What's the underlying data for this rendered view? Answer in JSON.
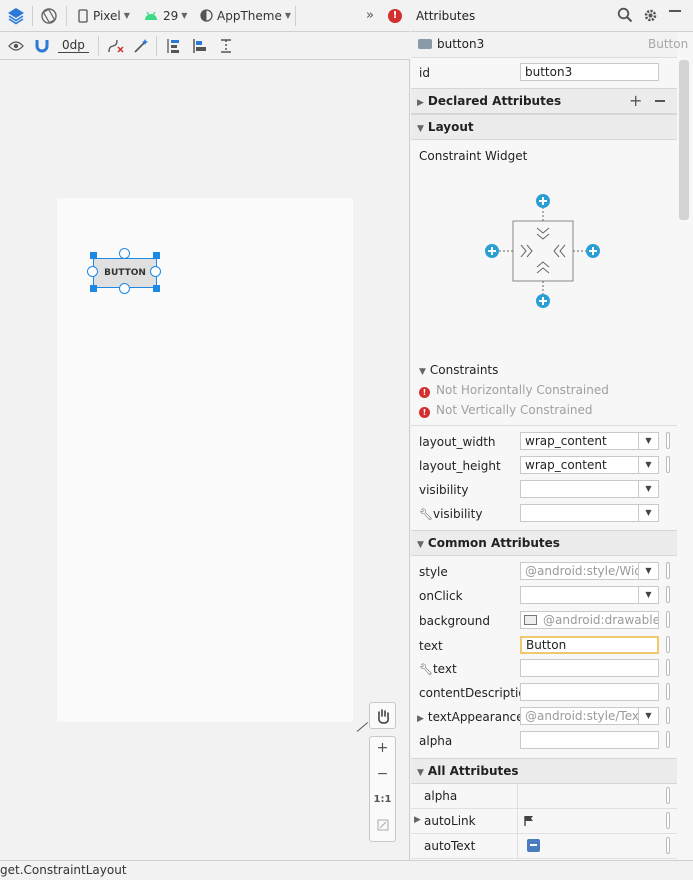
{
  "toolbar": {
    "device": "Pixel",
    "api_level": "29",
    "theme": "AppTheme",
    "margin": "0dp",
    "overflow": "»"
  },
  "canvas": {
    "button_label": "BUTTON",
    "zoom_in": "+",
    "zoom_out": "−",
    "zoom_reset": "1:1"
  },
  "status": {
    "text": "get.ConstraintLayout"
  },
  "attributes": {
    "title": "Attributes",
    "component_name": "button3",
    "component_type": "Button",
    "id_label": "id",
    "id_value": "button3",
    "declared_section": "Declared Attributes",
    "layout_section": "Layout",
    "constraint_widget_label": "Constraint Widget",
    "constraints_label": "Constraints",
    "constraint_errors": [
      "Not Horizontally Constrained",
      "Not Vertically Constrained"
    ],
    "layout_rows": [
      {
        "label": "layout_width",
        "value": "wrap_content"
      },
      {
        "label": "layout_height",
        "value": "wrap_content"
      },
      {
        "label": "visibility",
        "value": ""
      },
      {
        "label": "visibility",
        "value": ""
      }
    ],
    "common_section": "Common Attributes",
    "common_rows": [
      {
        "label": "style",
        "value": "@android:style/Wid"
      },
      {
        "label": "onClick",
        "value": ""
      },
      {
        "label": "background",
        "value": "@android:drawable/b"
      },
      {
        "label": "text",
        "value": "Button"
      },
      {
        "label": "text",
        "value": ""
      },
      {
        "label": "contentDescription",
        "value": ""
      },
      {
        "label": "textAppearance",
        "value": "@android:style/Tex"
      },
      {
        "label": "alpha",
        "value": ""
      }
    ],
    "all_section": "All Attributes",
    "all_rows": [
      {
        "label": "alpha"
      },
      {
        "label": "autoLink"
      },
      {
        "label": "autoText"
      }
    ]
  },
  "colors": {
    "accent": "#1e88e5",
    "error": "#d32f2f",
    "android_green": "#3ddc84",
    "focus_border": "#f0c86e"
  }
}
